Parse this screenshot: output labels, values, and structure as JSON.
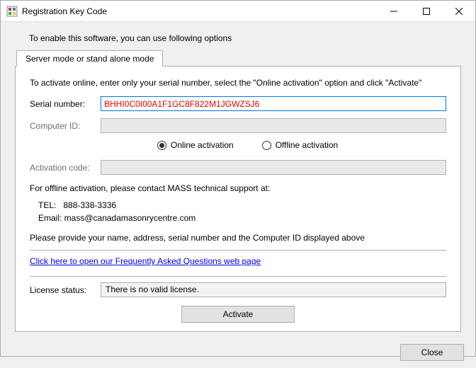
{
  "window": {
    "title": "Registration Key Code",
    "minimize": "–",
    "maximize": "☐",
    "close": "✕"
  },
  "intro": "To enable this software, you can use following options",
  "tab": {
    "label": "Server mode or stand alone mode"
  },
  "instruction": "To activate online, enter only your serial number, select the \"Online activation\" option and click \"Activate\"",
  "fields": {
    "serial_label": "Serial number:",
    "serial_value": "BHHI0C0I00A1F1GC8F822M1JGWZSJ6",
    "computer_label": "Computer ID:",
    "computer_value": "",
    "activation_label": "Activation code:",
    "activation_value": ""
  },
  "radios": {
    "online": "Online activation",
    "offline": "Offline activation",
    "selected": "online"
  },
  "contact": {
    "line1": "For offline activation, please contact MASS technical support at:",
    "tel": "TEL:   888-338-3336",
    "email": "Email: mass@canadamasonrycentre.com",
    "provide": "Please provide your name, address, serial number and the Computer ID displayed above"
  },
  "faq_link": "Click here to open our Frequently Asked Questions web page",
  "license": {
    "label": "License status:",
    "value": "There is no valid license."
  },
  "buttons": {
    "activate": "Activate",
    "close": "Close"
  }
}
